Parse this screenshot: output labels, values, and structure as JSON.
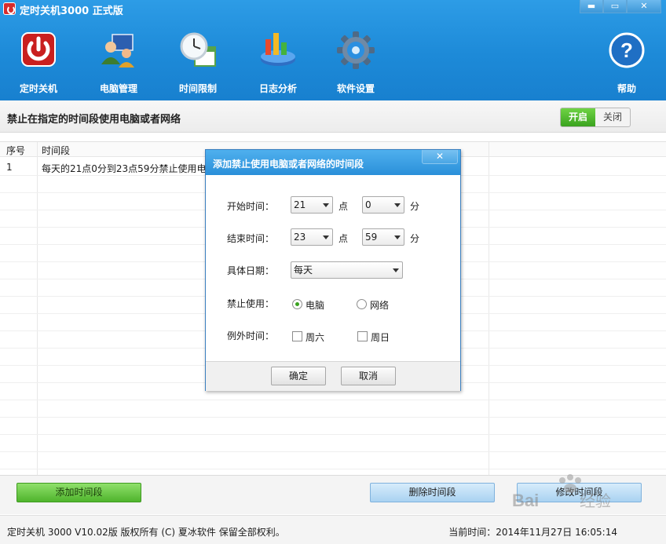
{
  "window": {
    "title": "定时关机3000 正式版",
    "controls": [
      "▬",
      "▭",
      "✕"
    ]
  },
  "toolbar": {
    "items": [
      {
        "label": "定时关机",
        "icon": "power-icon"
      },
      {
        "label": "电脑管理",
        "icon": "computer-manage-icon"
      },
      {
        "label": "时间限制",
        "icon": "clock-calendar-icon"
      },
      {
        "label": "日志分析",
        "icon": "chart-icon"
      },
      {
        "label": "软件设置",
        "icon": "gear-icon"
      }
    ],
    "help": {
      "label": "帮助",
      "icon": "help-icon"
    }
  },
  "section": {
    "title": "禁止在指定的时间段使用电脑或者网络",
    "toggle_on": "开启",
    "toggle_off": "关闭"
  },
  "table": {
    "headers": [
      "序号",
      "时间段"
    ],
    "rows": [
      {
        "index": "1",
        "period": "每天的21点0分到23点59分禁止使用电脑"
      }
    ]
  },
  "buttons": {
    "add": "添加时间段",
    "delete": "删除时间段",
    "edit": "修改时间段"
  },
  "status": {
    "copyright": "定时关机 3000 V10.02版 版权所有 (C) 夏冰软件 保留全部权利。",
    "current_time": "当前时间：2014年11月27日 16:05:14"
  },
  "dialog": {
    "title": "添加禁止使用电脑或者网络的时间段",
    "close": "✕",
    "start_label": "开始时间：",
    "start_hour": "21",
    "start_minute": "0",
    "end_label": "结束时间：",
    "end_hour": "23",
    "end_minute": "59",
    "hour_unit": "点",
    "minute_unit": "分",
    "date_label": "具体日期：",
    "date_value": "每天",
    "ban_label": "禁止使用：",
    "ban_computer": "电脑",
    "ban_network": "网络",
    "exception_label": "例外时间：",
    "saturday": "周六",
    "sunday": "周日",
    "ok": "确定",
    "cancel": "取消"
  },
  "watermark": "Bai 经验"
}
